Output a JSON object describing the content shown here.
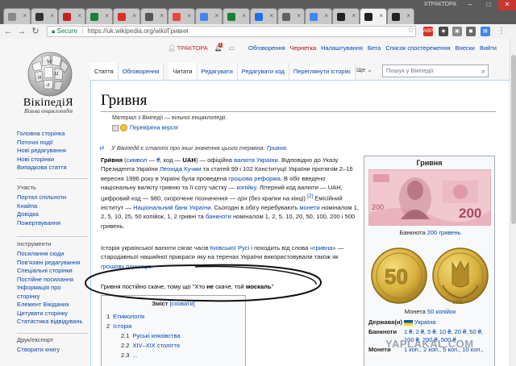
{
  "browser": {
    "window_name": "ХТРАКТОРА",
    "tab_count_icons": [
      "tab-1",
      "tab-2",
      "tab-3",
      "tab-4",
      "tab-5",
      "tab-6",
      "tab-7",
      "tab-8",
      "tab-9",
      "tab-10",
      "tab-11",
      "tab-12",
      "tab-13",
      "tab-14",
      "tab-15"
    ],
    "secure_label": "Secure",
    "url": "https://uk.wikipedia.org/wiki/Гривня"
  },
  "wiki": {
    "wordmark": "ВікіпедіЯ",
    "tagline": "Вільна енциклопедія",
    "nav_main": [
      "Головна сторінка",
      "Поточні події",
      "Нові редагування",
      "Нові сторінки",
      "Випадкова стаття"
    ],
    "participation_heading": "Участь",
    "nav_participation": [
      "Портал спільноти",
      "Кнайпа",
      "Довідка",
      "Пожертвування"
    ],
    "tools_heading": "Інструменти",
    "nav_tools": [
      "Посилання сюди",
      "Пов'язані редагування",
      "Спеціальні сторінки",
      "Постійне посилання",
      "Інформація про",
      "сторінку",
      "Елемент Вікіданих",
      "Цитувати сторінку",
      "Статистика відвідувань"
    ],
    "print_heading": "Друк/експорт",
    "nav_print": [
      "Створити книгу"
    ],
    "personal": {
      "user": "ТРАКТОРА",
      "notif_count": "1",
      "links": [
        "Обговорення",
        "Чернетка",
        "Налаштування",
        "Бета",
        "Список спостереження",
        "Внески",
        "Вийти"
      ]
    },
    "tabs": {
      "left": [
        "Стаття",
        "Обговорення"
      ],
      "right": [
        "Читати",
        "Редагувати",
        "Редагувати код",
        "Переглянути історію"
      ],
      "more": "Ще",
      "search_placeholder": "Пошук у Вікіпедії"
    },
    "article": {
      "title": "Гривня",
      "site_sub": "Матеріал з Вікіпедії — вільної енциклопедії.",
      "flagged": "Перевірена версія",
      "hatnote_text": "У Вікіпедії є статті про інші значення цього терміна: ",
      "hatnote_link": "Гривня",
      "p1": [
        {
          "t": "Гри́вня",
          "b": true
        },
        {
          "t": " ("
        },
        {
          "t": "символ",
          "l": true
        },
        {
          "t": " — "
        },
        {
          "t": "₴",
          "l": true
        },
        {
          "t": ", код — "
        },
        {
          "t": "UAH",
          "b": true
        },
        {
          "t": ") — офіційна "
        },
        {
          "t": "валюта",
          "l": true
        },
        {
          "t": " "
        },
        {
          "t": "України",
          "l": true
        },
        {
          "t": ". Відповідно до Указу Президента України "
        },
        {
          "t": "Леоніда Кучми",
          "l": true
        },
        {
          "t": " та статей 99 і 102 Конституції України протягом 2–16 вересня 1996 року в Україні була проведена "
        },
        {
          "t": "грошова реформа",
          "l": true
        },
        {
          "t": ". В обіг введено національну валюту гривню та її соту частку — "
        },
        {
          "t": "копійку",
          "l": true
        },
        {
          "t": ". Літерний код валюти — UAH, цифровий код — 980, скорочене позначення — "
        },
        {
          "t": "грн",
          "i": true
        },
        {
          "t": " (без крапки на кінці)."
        },
        {
          "t": "[2]",
          "l": true,
          "sup": true
        },
        {
          "t": " Емісійний інститут — "
        },
        {
          "t": "Національний банк України",
          "l": true
        },
        {
          "t": ". Сьогодні в обігу перебувають "
        },
        {
          "t": "монети",
          "l": true
        },
        {
          "t": " номіналом 1, 2, 5, 10, 25, 50 копійок, 1, 2 гривні та "
        },
        {
          "t": "банкноти",
          "l": true
        },
        {
          "t": " номіналом 1, 2, 5, 10, 20, 50, 100, 200 і 500 гривень."
        }
      ],
      "p2": [
        {
          "t": "Історія української валюти сягає часів "
        },
        {
          "t": "Київської Русі",
          "l": true
        },
        {
          "t": " і походить від слова «"
        },
        {
          "t": "гривна",
          "l": true
        },
        {
          "t": "» — стародавньої нашийної прикраси яку на теренах України використовували також як "
        },
        {
          "t": "грошову одиницю",
          "l": true
        },
        {
          "t": "."
        }
      ],
      "note": [
        {
          "t": "Гривня постійно скаче, тому що \"Хто "
        },
        {
          "t": "не",
          "b": true
        },
        {
          "t": " скаче, той "
        },
        {
          "t": "москаль",
          "b": true
        },
        {
          "t": "\""
        }
      ],
      "toc": {
        "title": "Зміст",
        "toggle": "[сховати]",
        "items": [
          {
            "n": "1",
            "label": "Етимологія",
            "sub": false
          },
          {
            "n": "2",
            "label": "Історія",
            "sub": false
          },
          {
            "n": "2.1",
            "label": "Руські князівства",
            "sub": true
          },
          {
            "n": "2.2",
            "label": "XIV–XIX століття",
            "sub": true
          },
          {
            "n": "2.3",
            "label": "...",
            "sub": true
          }
        ]
      }
    },
    "infobox": {
      "title": "Гривня",
      "banknote_caption_text": "Банкнота ",
      "banknote_caption_link": "200 гривень",
      "banknote_value": "200",
      "coin_value": "50",
      "coin_year": "1992",
      "coin_caption_text": "Монета ",
      "coin_caption_link": "50 копійок",
      "state_label": "Держава(и)",
      "state_value": "Україна",
      "banknotes_label": "Банкноти",
      "banknotes_value": "1 ₴, 2 ₴, 5 ₴, 10 ₴, 20 ₴, 50 ₴,",
      "banknotes_value2": "100 ₴, 200 ₴, 500 ₴",
      "coins_label": "Монети",
      "coins_value": "1 коп., 2 коп., 5 коп., 10 коп.,"
    },
    "watermark": "YAPLAKAL.COM"
  },
  "colors": {
    "link": "#0645ad",
    "redlink": "#ba0000",
    "annotation_oval": "#000000",
    "chrome_dark": "#5b5b5b"
  }
}
